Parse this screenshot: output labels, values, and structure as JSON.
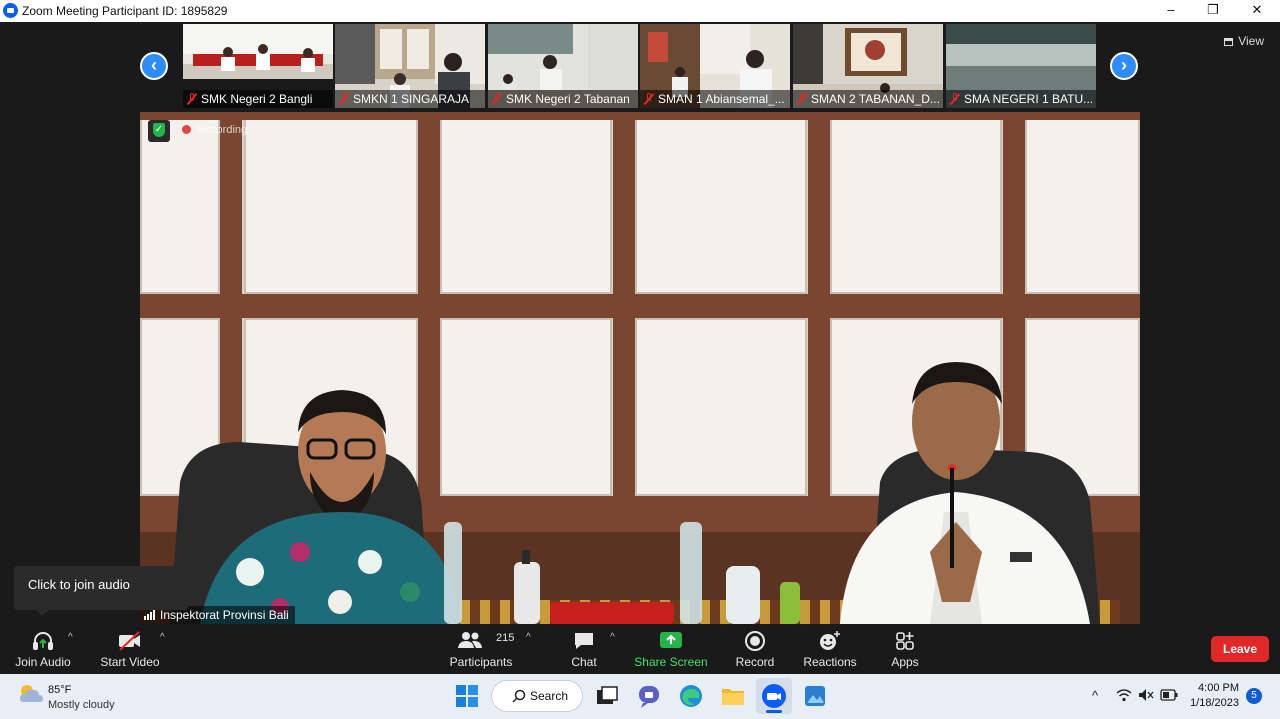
{
  "window": {
    "title": "Zoom Meeting Participant ID: 1895829",
    "controls": [
      "–",
      "❐",
      "✕"
    ]
  },
  "gallery": {
    "prev_icon": "‹",
    "next_icon": "›",
    "view_label": "View",
    "participants": [
      {
        "name": "SMK Negeri 2 Bangli",
        "muted": true
      },
      {
        "name": "SMKN 1 SINGARAJA",
        "muted": true
      },
      {
        "name": "SMK Negeri 2 Tabanan",
        "muted": true
      },
      {
        "name": "SMAN 1 Abiansemal_...",
        "muted": true
      },
      {
        "name": "SMAN 2 TABANAN_D...",
        "muted": true
      },
      {
        "name": "SMA NEGERI 1 BATU...",
        "muted": true
      }
    ]
  },
  "main_video": {
    "recording_label": "Recording",
    "speaker_name": "Inspektorat Provinsi Bali"
  },
  "tooltip": {
    "text": "Click to join audio"
  },
  "toolbar": {
    "join_audio": "Join Audio",
    "start_video": "Start Video",
    "participants_label": "Participants",
    "participants_count": "215",
    "chat": "Chat",
    "share_screen": "Share Screen",
    "record": "Record",
    "reactions": "Reactions",
    "apps": "Apps",
    "leave": "Leave",
    "caret": "^",
    "accent": "#2d8cff",
    "share_color": "#25b34a",
    "leave_color": "#e02828"
  },
  "taskbar": {
    "weather_temp": "85°F",
    "weather_condition": "Mostly cloudy",
    "search_label": "Search",
    "time": "4:00 PM",
    "date": "1/18/2023",
    "notification_count": "5",
    "apps": [
      "windows-start-icon",
      "task-view-icon",
      "chat-icon",
      "edge-icon",
      "file-explorer-icon",
      "zoom-icon",
      "photos-icon"
    ]
  }
}
